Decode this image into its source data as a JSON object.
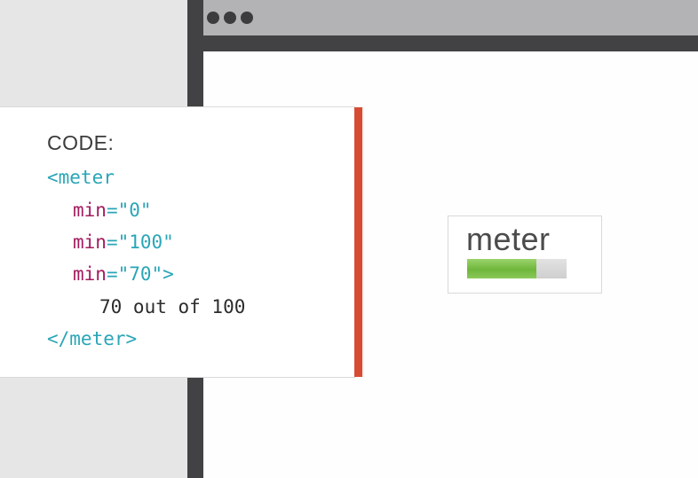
{
  "code_card": {
    "heading": "CODE:",
    "open_tag": "<meter",
    "attributes": [
      {
        "name": "min",
        "eq": "=",
        "value": "\"0\"",
        "suffix": ""
      },
      {
        "name": "min",
        "eq": "=",
        "value": "\"100\"",
        "suffix": ""
      },
      {
        "name": "min",
        "eq": "=",
        "value": "\"70\"",
        "suffix": ">"
      }
    ],
    "inner_text": "70 out of 100",
    "close_tag": "</meter>"
  },
  "preview": {
    "label": "meter",
    "value": 70,
    "min": 0,
    "max": 100
  },
  "colors": {
    "accent_bar": "#d84b33",
    "tag": "#2aa6b7",
    "attribute": "#a31c5e",
    "meter_fill": "#7cbf47",
    "browser_frame": "#424244"
  },
  "icons": {
    "window_controls": [
      "window-dot-icon",
      "window-dot-icon",
      "window-dot-icon"
    ]
  }
}
